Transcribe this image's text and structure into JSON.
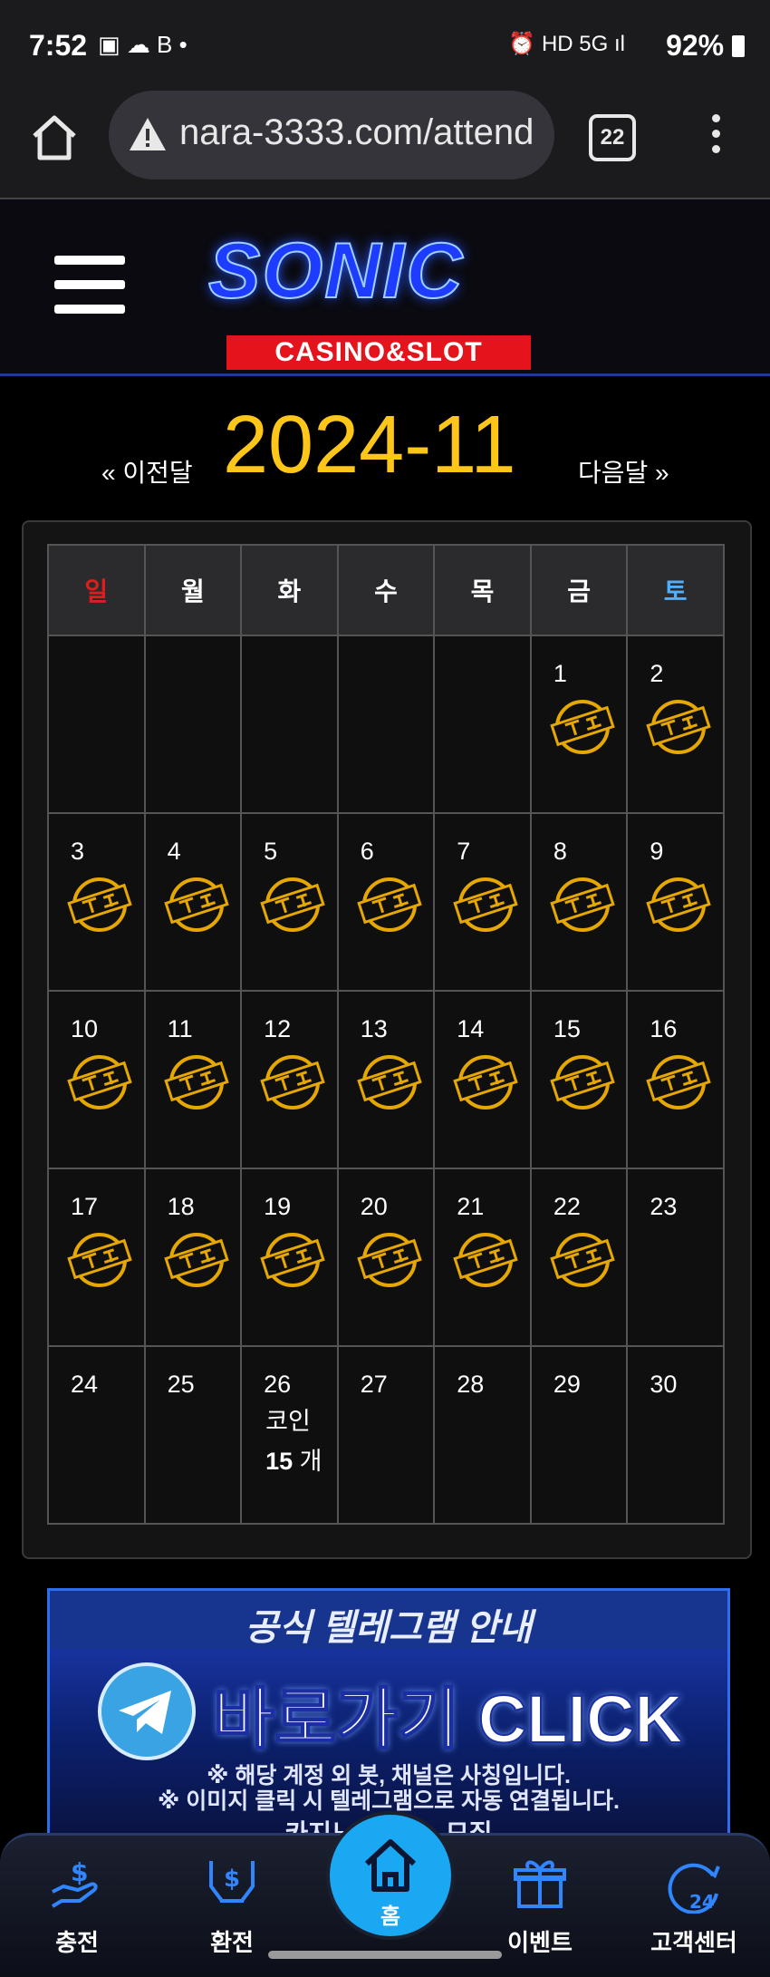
{
  "status_bar": {
    "time": "7:52",
    "left_icons": "▣ ☁ B •",
    "right_icons": "⏰ HD 5G ıl",
    "battery": "92%"
  },
  "browser": {
    "url": "nara-3333.com/attend",
    "tab_count": "22"
  },
  "site": {
    "logo_main": "SONIC",
    "logo_sub": "CASINO&SLOT"
  },
  "calendar": {
    "prev_label": "« 이전달",
    "month": "2024-11",
    "next_label": "다음달 »",
    "weekdays": [
      "일",
      "월",
      "화",
      "수",
      "목",
      "금",
      "토"
    ],
    "weekday_colors": {
      "sun": "#e01d1d",
      "sat": "#4fb0ff",
      "default": "#ffffff"
    },
    "stamp_color": "#e6a800",
    "weeks": [
      [
        null,
        null,
        null,
        null,
        null,
        {
          "day": "1",
          "stamp": true
        },
        {
          "day": "2",
          "stamp": true
        }
      ],
      [
        {
          "day": "3",
          "stamp": true
        },
        {
          "day": "4",
          "stamp": true
        },
        {
          "day": "5",
          "stamp": true
        },
        {
          "day": "6",
          "stamp": true
        },
        {
          "day": "7",
          "stamp": true
        },
        {
          "day": "8",
          "stamp": true
        },
        {
          "day": "9",
          "stamp": true
        }
      ],
      [
        {
          "day": "10",
          "stamp": true
        },
        {
          "day": "11",
          "stamp": true
        },
        {
          "day": "12",
          "stamp": true
        },
        {
          "day": "13",
          "stamp": true
        },
        {
          "day": "14",
          "stamp": true
        },
        {
          "day": "15",
          "stamp": true
        },
        {
          "day": "16",
          "stamp": true
        }
      ],
      [
        {
          "day": "17",
          "stamp": true
        },
        {
          "day": "18",
          "stamp": true
        },
        {
          "day": "19",
          "stamp": true
        },
        {
          "day": "20",
          "stamp": true
        },
        {
          "day": "21",
          "stamp": true
        },
        {
          "day": "22",
          "stamp": true
        },
        {
          "day": "23",
          "stamp": false
        }
      ],
      [
        {
          "day": "24",
          "stamp": false
        },
        {
          "day": "25",
          "stamp": false
        },
        {
          "day": "26",
          "stamp": false,
          "note_line1": "코인",
          "note_amount": "15",
          "note_unit": " 개"
        },
        {
          "day": "27",
          "stamp": false
        },
        {
          "day": "28",
          "stamp": false
        },
        {
          "day": "29",
          "stamp": false
        },
        {
          "day": "30",
          "stamp": false
        }
      ]
    ]
  },
  "banner": {
    "title": "공식 텔레그램 안내",
    "cta": "바로가기 CLICK",
    "note1": "※ 해당 계정 외 봇, 채널은 사칭입니다.",
    "note2": "※ 이미지 클릭 시 텔레그램으로 자동 연결됩니다.",
    "note3": "카지노 ○○○○○ 모집"
  },
  "bottom_nav": {
    "deposit": "충전",
    "withdraw": "환전",
    "home": "홈",
    "event": "이벤트",
    "support": "고객센터"
  }
}
